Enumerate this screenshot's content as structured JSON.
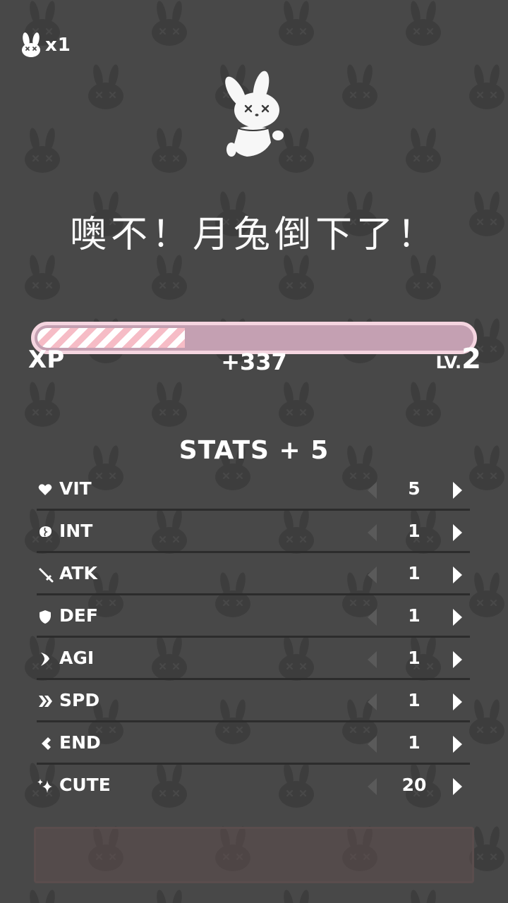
{
  "hud": {
    "lives_count": "x1"
  },
  "icons": {
    "lives": "bunny-head-icon",
    "hero": "defeated-moon-rabbit",
    "background": "bunny-pattern"
  },
  "defeat_message": "噢不！月兔倒下了！",
  "xp": {
    "label": "XP",
    "gain": "+337",
    "level_prefix": "LV.",
    "level": "2",
    "progress": 0.34
  },
  "stats": {
    "heading": "STATS + 5",
    "items": [
      {
        "name": "VIT",
        "value": "5",
        "icon": "heart-icon"
      },
      {
        "name": "INT",
        "value": "1",
        "icon": "brain-icon"
      },
      {
        "name": "ATK",
        "value": "1",
        "icon": "sword-icon"
      },
      {
        "name": "DEF",
        "value": "1",
        "icon": "shield-icon"
      },
      {
        "name": "AGI",
        "value": "1",
        "icon": "agility-icon"
      },
      {
        "name": "SPD",
        "value": "1",
        "icon": "speed-icon"
      },
      {
        "name": "END",
        "value": "1",
        "icon": "endurance-icon"
      },
      {
        "name": "CUTE",
        "value": "20",
        "icon": "sparkle-icon"
      }
    ]
  },
  "colors": {
    "background": "#484848",
    "xp_frame": "#f5d5e0",
    "xp_track": "#c4a0b2",
    "xp_stripe": "#f6bcc6",
    "text": "#ffffff"
  }
}
